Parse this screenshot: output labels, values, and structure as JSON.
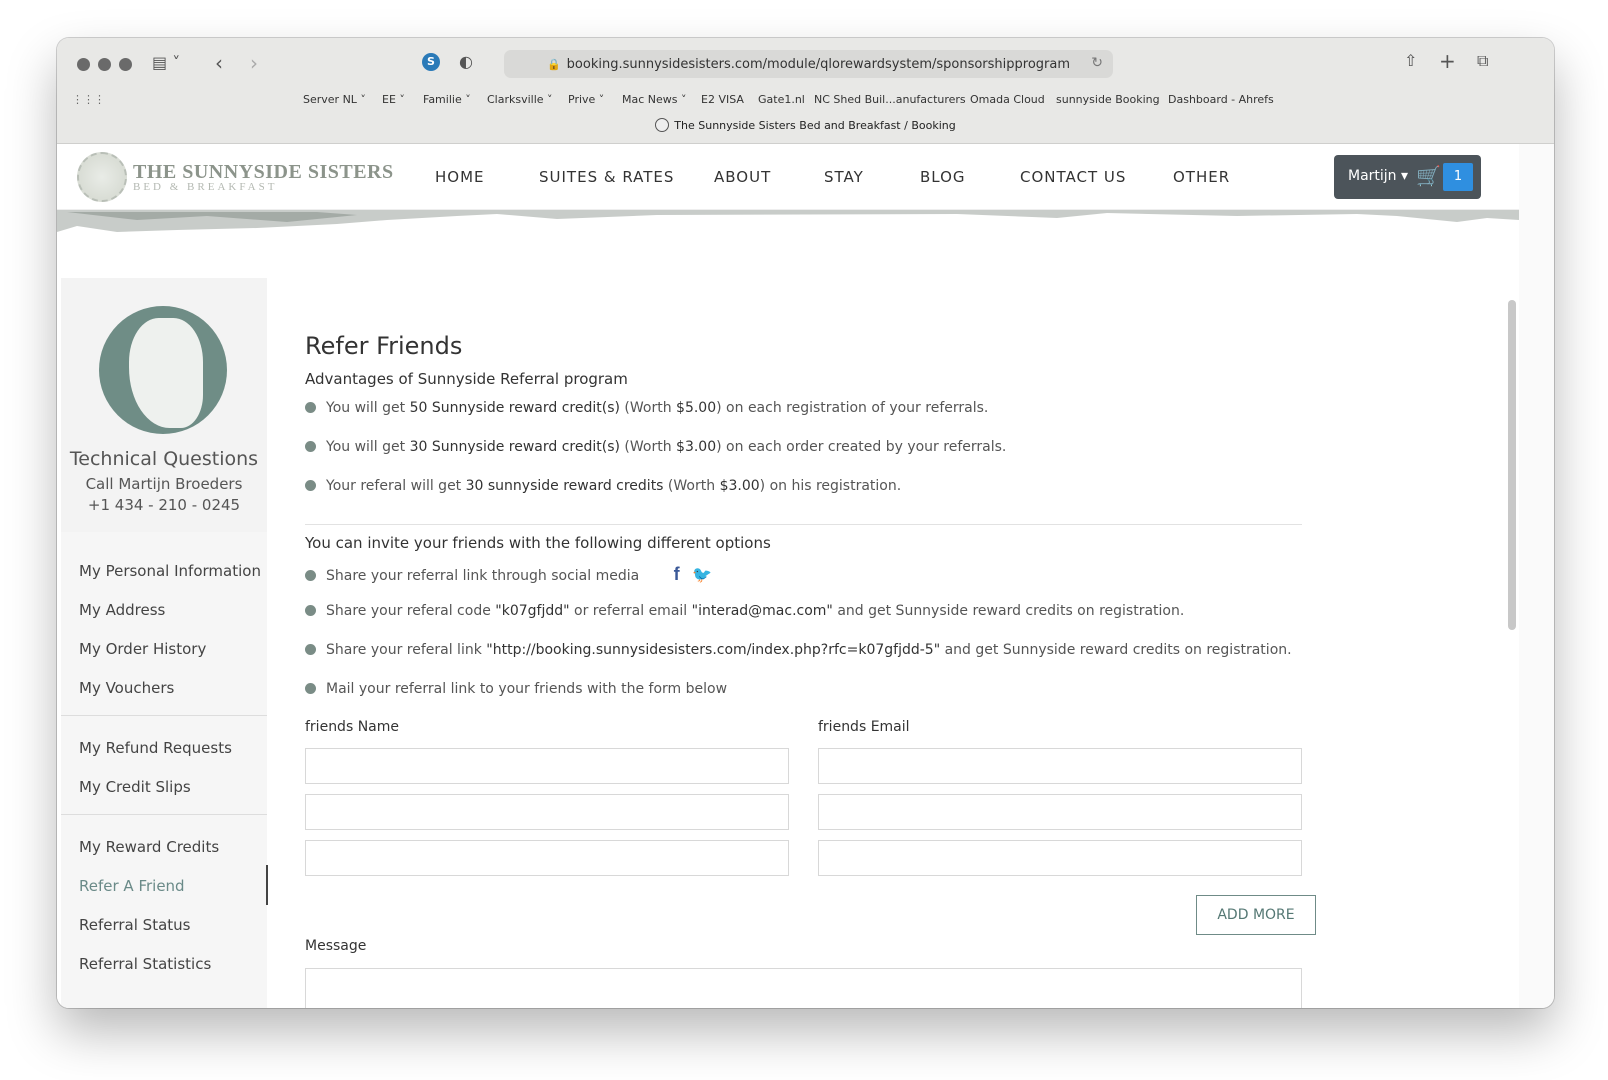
{
  "browser": {
    "url": "booking.sunnysidesisters.com/module/qlorewardsystem/sponsorshipprogram",
    "tab_title": "The Sunnyside Sisters Bed and Breakfast / Booking",
    "bookmarks": [
      "Server NL",
      "EE",
      "Familie",
      "Clarksville",
      "Prive",
      "Mac News",
      "E2 VISA",
      "Gate1.nl",
      "NC Shed Buil...anufacturers",
      "Omada Cloud",
      "sunnyside Booking",
      "Dashboard - Ahrefs"
    ]
  },
  "site": {
    "logo_line1": "THE SUNNYSIDE SISTERS",
    "logo_line2": "BED & BREAKFAST",
    "nav": [
      "HOME",
      "SUITES & RATES",
      "ABOUT",
      "STAY",
      "BLOG",
      "CONTACT US",
      "OTHER"
    ],
    "account_name": "Martijn",
    "cart_count": "1"
  },
  "sidebar": {
    "title": "Technical Questions",
    "line2": "Call Martijn Broeders",
    "line3": "+1 434 - 210 - 0245",
    "menu": [
      "My Personal Information",
      "My Address",
      "My Order History",
      "My Vouchers",
      "My Refund Requests",
      "My Credit Slips",
      "My Reward Credits",
      "Refer A Friend",
      "Referral Status",
      "Referral Statistics"
    ],
    "active_item": "Refer A Friend"
  },
  "main": {
    "title": "Refer Friends",
    "advantages_heading": "Advantages of Sunnyside Referral program",
    "adv1_pre": "You will get ",
    "adv1_bold": "50 Sunnyside reward credit(s)",
    "adv1_mid": " (Worth ",
    "adv1_worth": "$5.00",
    "adv1_post": ") on each registration of your referrals.",
    "adv2_pre": "You will get ",
    "adv2_bold": "30 Sunnyside reward credit(s)",
    "adv2_mid": " (Worth ",
    "adv2_worth": "$3.00",
    "adv2_post": ") on each order created by your referrals.",
    "adv3_pre": "Your referal will get ",
    "adv3_bold": "30 sunnyside reward credits",
    "adv3_mid": " (Worth ",
    "adv3_worth": "$3.00",
    "adv3_post": ") on his registration.",
    "invite_heading": "You can invite your friends with the following different options",
    "opt1": "Share your referral link through social media",
    "opt2_pre": "Share your referal code ",
    "opt2_code": "\"k07gfjdd\"",
    "opt2_mid": " or referral email ",
    "opt2_email": "\"interad@mac.com\"",
    "opt2_post": " and get Sunnyside reward credits on registration.",
    "opt3_pre": "Share your referal link ",
    "opt3_link": "\"http://booking.sunnysidesisters.com/index.php?rfc=k07gfjdd-5\"",
    "opt3_post": " and get Sunnyside reward credits on registration.",
    "opt4": "Mail your referral link to your friends with the form below",
    "name_label": "friends Name",
    "email_label": "friends Email",
    "add_more": "ADD MORE",
    "message_label": "Message"
  }
}
